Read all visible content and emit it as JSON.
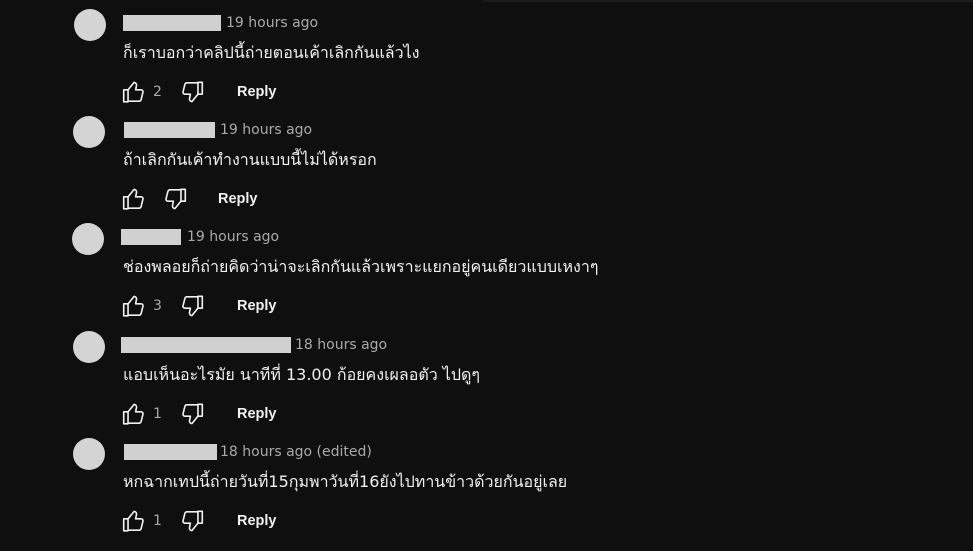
{
  "comments": [
    {
      "timestamp": "19 hours ago",
      "text": "ก็เราบอกว่าคลิปนี้ถ่ายตอนเค้าเลิกกันแล้วไง",
      "likes": "2",
      "reply_label": "Reply"
    },
    {
      "timestamp": "19 hours ago",
      "text": "ถ้าเลิกกันเค้าทำงานแบบนี้ไม่ได้หรอก",
      "likes": "",
      "reply_label": "Reply"
    },
    {
      "timestamp": "19 hours ago",
      "text": "ช่องพลอยก็ถ่ายคิดว่าน่าจะเลิกกันแล้วเพราะแยกอยู่คนเดียวแบบเหงาๆ",
      "likes": "3",
      "reply_label": "Reply"
    },
    {
      "timestamp": "18 hours ago",
      "text": "แอบเห็นอะไรมัย นาทีที่ 13.00 ก้อยคงเผลอตัว ไปดูๆ",
      "likes": "1",
      "reply_label": "Reply"
    },
    {
      "timestamp": "18 hours ago (edited)",
      "text": "หกฉากเทปนี้ถ่ายวันที่15กุมพาวันที่16ยังไปทานข้าวด้วยกันอยู่เลย",
      "likes": "1",
      "reply_label": "Reply"
    }
  ],
  "icons": {
    "like": "thumbs-up-icon",
    "dislike": "thumbs-down-icon"
  },
  "colors": {
    "background": "#0f0f0f",
    "text": "#f1f1f1",
    "secondary_text": "#aaaaaa",
    "redacted_placeholder": "#d0d0d0"
  }
}
